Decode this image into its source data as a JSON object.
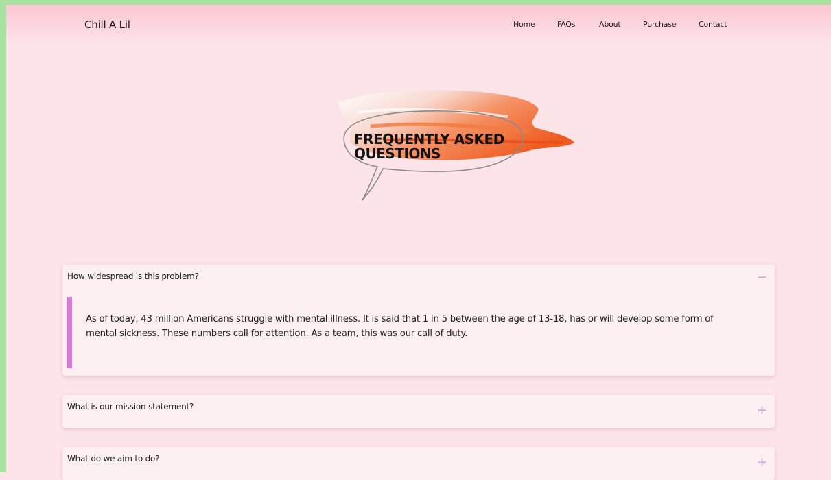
{
  "nav": {
    "brand": "Chill A Lil",
    "links": [
      "Home",
      "FAQs",
      "About",
      "Purchase",
      "Contact"
    ]
  },
  "hero": {
    "title": "Frequently Asked Questions"
  },
  "faq": {
    "items": [
      {
        "question": "How widespread is this problem?",
        "toggle": "−",
        "answer": "As of today, 43 million Americans struggle with mental illness. It is said that 1 in 5 between the age of 13-18, has or will develop some form of mental sickness. These numbers call for attention. As a team, this was our call of duty.",
        "expanded": true
      },
      {
        "question": "What is our mission statement?",
        "toggle": "+",
        "expanded": false
      },
      {
        "question": "What do we aim to do?",
        "toggle": "+",
        "expanded": false
      }
    ]
  },
  "colors": {
    "background": "#fde4e9",
    "frame": "#a6e3a1",
    "accent_bar": "#d77bd6",
    "toggle": "#c9a0dc",
    "card": "#fcefef"
  }
}
